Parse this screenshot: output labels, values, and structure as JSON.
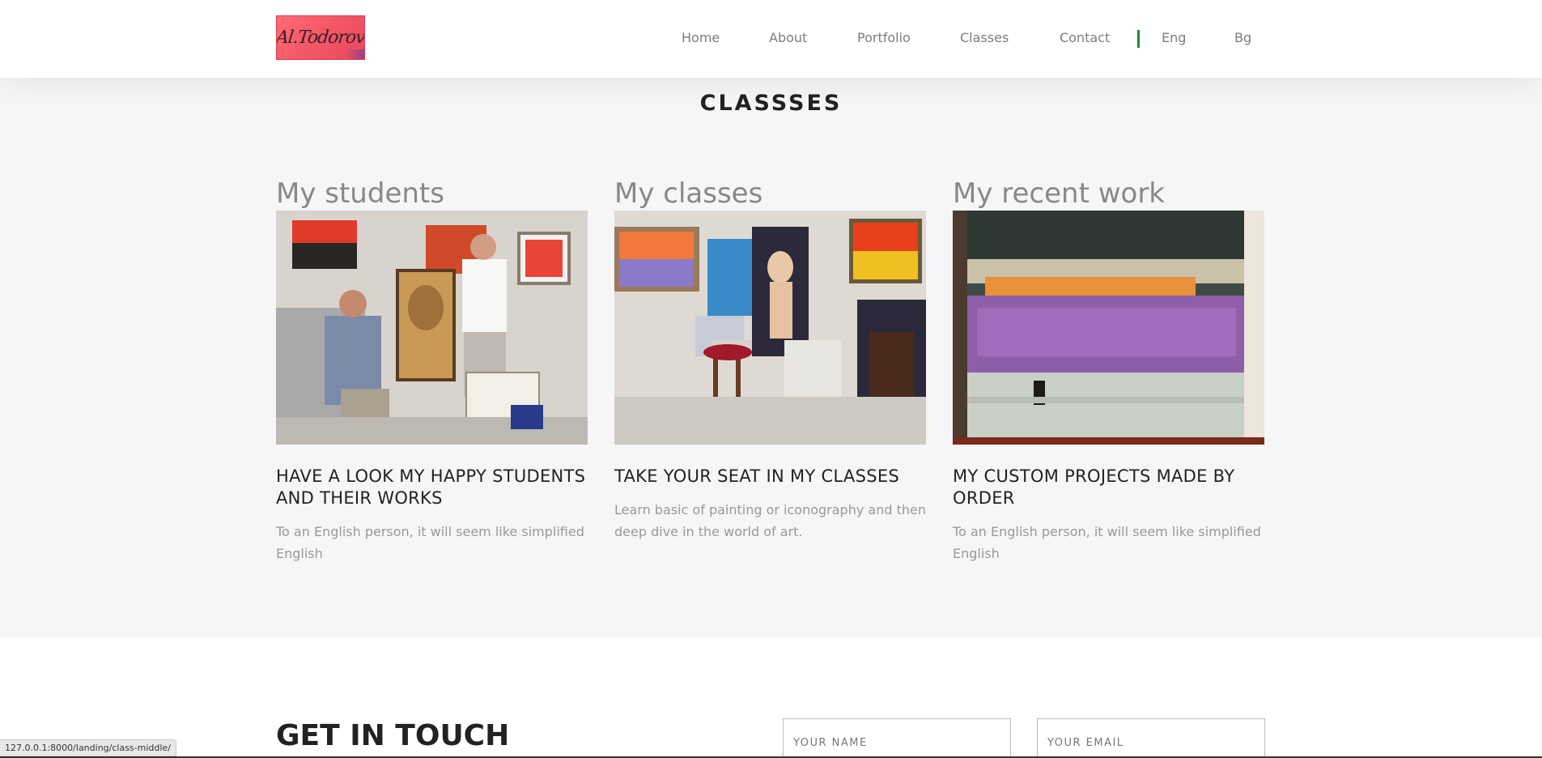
{
  "header": {
    "logo_text": "Al.Todorov",
    "nav": [
      {
        "label": "Home"
      },
      {
        "label": "About"
      },
      {
        "label": "Portfolio"
      },
      {
        "label": "Classes"
      },
      {
        "label": "Contact"
      }
    ],
    "languages": [
      {
        "label": "Eng"
      },
      {
        "label": "Bg"
      }
    ],
    "accent_color": "#1f8b2a"
  },
  "section": {
    "title": "CLASSSES"
  },
  "cards": [
    {
      "heading": "My students",
      "subtitle": "HAVE A LOOK MY HAPPY STUDENTS AND THEIR WORKS",
      "text": "To an English person, it will seem like simplified English"
    },
    {
      "heading": "My classes",
      "subtitle": "TAKE YOUR SEAT IN MY CLASSES",
      "text": "Learn basic of painting or iconography and then deep dive in the world of art."
    },
    {
      "heading": "My recent work",
      "subtitle": "MY CUSTOM PROJECTS MADE BY ORDER",
      "text": "To an English person, it will seem like simplified English"
    }
  ],
  "contact": {
    "title": "GET IN TOUCH",
    "name_placeholder": "YOUR NAME",
    "email_placeholder": "YOUR EMAIL"
  },
  "statusbar": {
    "url": "127.0.0.1:8000/landing/class-middle/"
  }
}
